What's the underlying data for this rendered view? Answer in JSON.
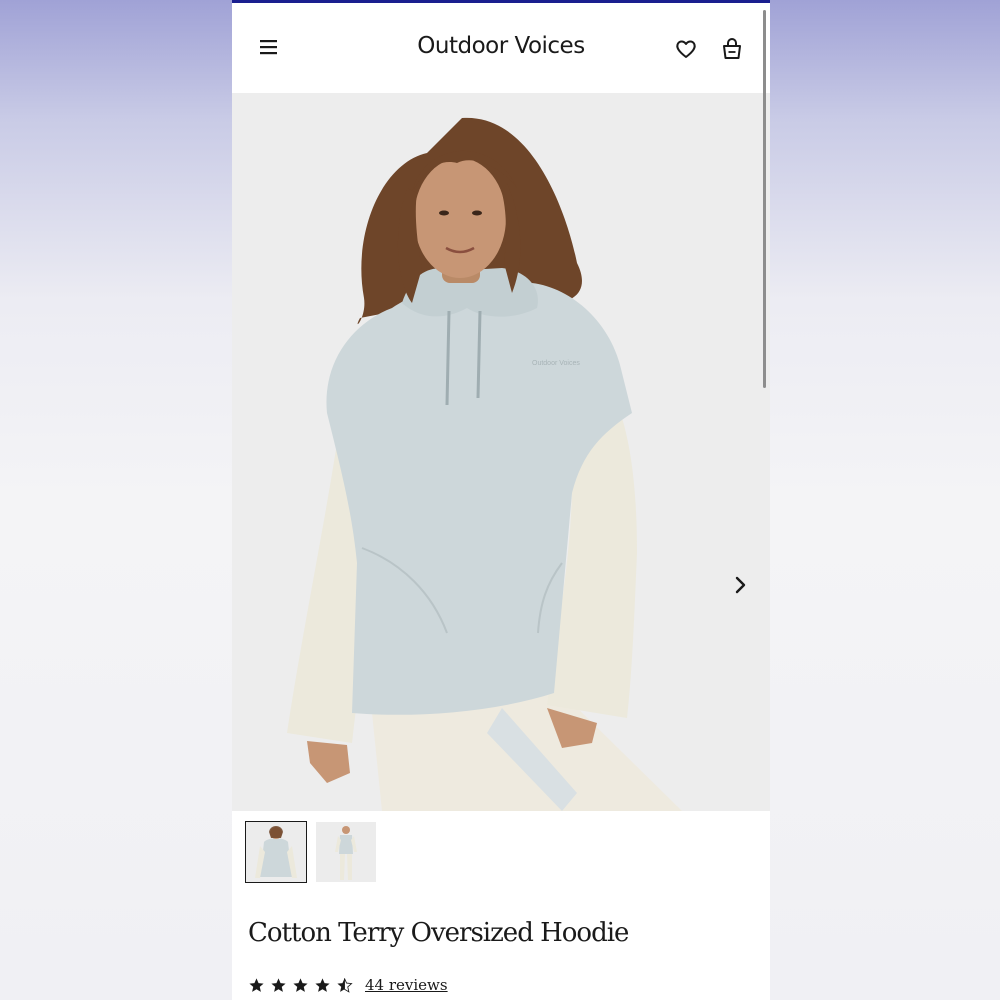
{
  "header": {
    "brand": "Outdoor Voices",
    "menu_icon": "hamburger-menu-icon",
    "wishlist_icon": "heart-icon",
    "bag_icon": "shopping-bag-icon"
  },
  "gallery": {
    "next_icon": "chevron-right-icon",
    "image_count": 2,
    "active_index": 0
  },
  "product": {
    "title": "Cotton Terry Oversized Hoodie",
    "rating": 4.5,
    "rating_max": 5,
    "reviews_label": "44 reviews"
  },
  "colors": {
    "accent_bar": "#1a1f8f",
    "hoodie_body": "#cdd7da",
    "hoodie_sleeves": "#ece9dc",
    "text": "#1a1a1a"
  }
}
